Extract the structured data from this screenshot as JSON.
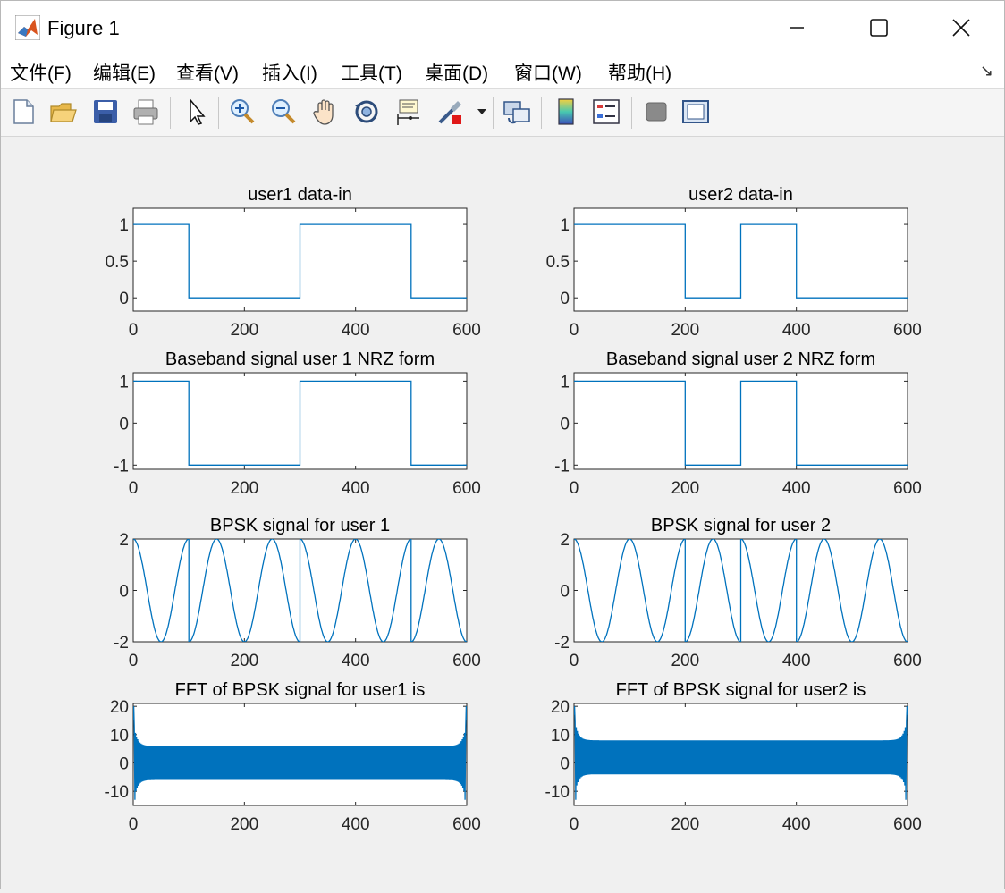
{
  "window": {
    "title": "Figure 1"
  },
  "menu": {
    "items": [
      "文件(F)",
      "编辑(E)",
      "查看(V)",
      "插入(I)",
      "工具(T)",
      "桌面(D)",
      "窗口(W)",
      "帮助(H)"
    ]
  },
  "toolbar": {
    "icons": [
      "new-figure-icon",
      "open-file-icon",
      "save-icon",
      "print-icon",
      "pointer-icon",
      "zoom-in-icon",
      "zoom-out-icon",
      "pan-hand-icon",
      "rotate-3d-icon",
      "data-cursor-icon",
      "brush-icon",
      "link-plot-icon",
      "colorbar-icon",
      "legend-icon",
      "hide-plot-tools-icon",
      "show-plot-tools-icon"
    ]
  },
  "colors": {
    "line": "#0072bd",
    "axes_bg": "#ffffff",
    "figure_bg": "#f0f0f0"
  },
  "chart_data": [
    {
      "type": "line",
      "title": "user1 data-in",
      "xlim": [
        0,
        600
      ],
      "ylim": [
        -0.18,
        1.22
      ],
      "xticks": [
        0,
        200,
        400,
        600
      ],
      "yticks": [
        0,
        0.5,
        1
      ],
      "ytick_labels": [
        "0",
        "0.5",
        "1"
      ],
      "kind": "step",
      "levels": [
        1,
        0,
        0,
        1,
        1,
        0
      ],
      "xlabel": "",
      "ylabel": ""
    },
    {
      "type": "line",
      "title": "user2 data-in",
      "xlim": [
        0,
        600
      ],
      "ylim": [
        -0.18,
        1.22
      ],
      "xticks": [
        0,
        200,
        400,
        600
      ],
      "yticks": [
        0,
        0.5,
        1
      ],
      "ytick_labels": [
        "0",
        "0.5",
        "1"
      ],
      "kind": "step",
      "levels": [
        1,
        1,
        0,
        1,
        0,
        0
      ],
      "xlabel": "",
      "ylabel": ""
    },
    {
      "type": "line",
      "title": "Baseband signal user 1 NRZ form",
      "xlim": [
        0,
        600
      ],
      "ylim": [
        -1.1,
        1.2
      ],
      "xticks": [
        0,
        200,
        400,
        600
      ],
      "yticks": [
        -1,
        0,
        1
      ],
      "ytick_labels": [
        "-1",
        "0",
        "1"
      ],
      "kind": "step",
      "levels": [
        1,
        -1,
        -1,
        1,
        1,
        -1
      ],
      "xlabel": "",
      "ylabel": ""
    },
    {
      "type": "line",
      "title": "Baseband signal user 2 NRZ form",
      "xlim": [
        0,
        600
      ],
      "ylim": [
        -1.1,
        1.2
      ],
      "xticks": [
        0,
        200,
        400,
        600
      ],
      "yticks": [
        -1,
        0,
        1
      ],
      "ytick_labels": [
        "-1",
        "0",
        "1"
      ],
      "kind": "step",
      "levels": [
        1,
        1,
        -1,
        1,
        -1,
        -1
      ],
      "xlabel": "",
      "ylabel": ""
    },
    {
      "type": "line",
      "title": "BPSK signal for user 1",
      "xlim": [
        0,
        600
      ],
      "ylim": [
        -2,
        2
      ],
      "xticks": [
        0,
        200,
        400,
        600
      ],
      "yticks": [
        -2,
        0,
        2
      ],
      "ytick_labels": [
        "-2",
        "0",
        "2"
      ],
      "kind": "bpsk",
      "levels": [
        1,
        -1,
        -1,
        1,
        1,
        -1
      ],
      "amplitude": 2,
      "period": 100,
      "xlabel": "",
      "ylabel": ""
    },
    {
      "type": "line",
      "title": "BPSK signal for user 2",
      "xlim": [
        0,
        600
      ],
      "ylim": [
        -2,
        2
      ],
      "xticks": [
        0,
        200,
        400,
        600
      ],
      "yticks": [
        -2,
        0,
        2
      ],
      "ytick_labels": [
        "-2",
        "0",
        "2"
      ],
      "kind": "bpsk",
      "levels": [
        1,
        1,
        -1,
        1,
        -1,
        -1
      ],
      "amplitude": 2,
      "period": 100,
      "xlabel": "",
      "ylabel": ""
    },
    {
      "type": "line",
      "title": "FFT of BPSK signal for user1 is",
      "xlim": [
        0,
        600
      ],
      "ylim": [
        -15,
        21
      ],
      "xticks": [
        0,
        200,
        400,
        600
      ],
      "yticks": [
        -10,
        0,
        10,
        20
      ],
      "ytick_labels": [
        "-10",
        "0",
        "10",
        "20"
      ],
      "kind": "fft",
      "center": 0,
      "envelope": 6,
      "edge_peak": 20,
      "edge_low": -13,
      "xlabel": "",
      "ylabel": ""
    },
    {
      "type": "line",
      "title": "FFT of BPSK signal for user2 is",
      "xlim": [
        0,
        600
      ],
      "ylim": [
        -15,
        21
      ],
      "xticks": [
        0,
        200,
        400,
        600
      ],
      "yticks": [
        -10,
        0,
        10,
        20
      ],
      "ytick_labels": [
        "-10",
        "0",
        "10",
        "20"
      ],
      "kind": "fft",
      "center": 2,
      "envelope": 6,
      "edge_peak": 20,
      "edge_low": -13,
      "xlabel": "",
      "ylabel": ""
    }
  ]
}
